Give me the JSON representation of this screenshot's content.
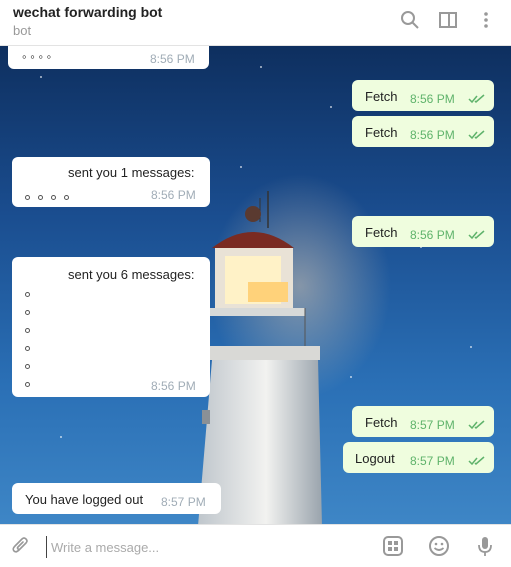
{
  "header": {
    "title": "wechat forwarding bot",
    "subtitle": "bot"
  },
  "messages": [
    {
      "dir": "in",
      "text": "◦ ◦ ◦ ◦",
      "time": "8:56 PM"
    },
    {
      "dir": "out",
      "text": "Fetch",
      "time": "8:56 PM"
    },
    {
      "dir": "out",
      "text": "Fetch",
      "time": "8:56 PM"
    },
    {
      "dir": "in",
      "text": "sent you 1 messages:",
      "time": "8:56 PM"
    },
    {
      "dir": "out",
      "text": "Fetch",
      "time": "8:56 PM"
    },
    {
      "dir": "in",
      "text": "sent you 6 messages:",
      "time": "8:56 PM"
    },
    {
      "dir": "out",
      "text": "Fetch",
      "time": "8:57 PM"
    },
    {
      "dir": "out",
      "text": "Logout",
      "time": "8:57 PM"
    },
    {
      "dir": "in",
      "text": "You have logged out",
      "time": "8:57 PM"
    }
  ],
  "composer": {
    "placeholder": "Write a message..."
  },
  "icons": {
    "search": "search-icon",
    "sidebar": "sidebar-toggle-icon",
    "more": "more-vertical-icon",
    "attach": "paperclip-icon",
    "commands": "commands-icon",
    "emoji": "emoji-icon",
    "mic": "microphone-icon"
  },
  "colors": {
    "outgoing_bubble": "#effdde",
    "incoming_bubble": "#ffffff",
    "read_check": "#5fb36b",
    "background_sky": "#1a4d8f"
  }
}
